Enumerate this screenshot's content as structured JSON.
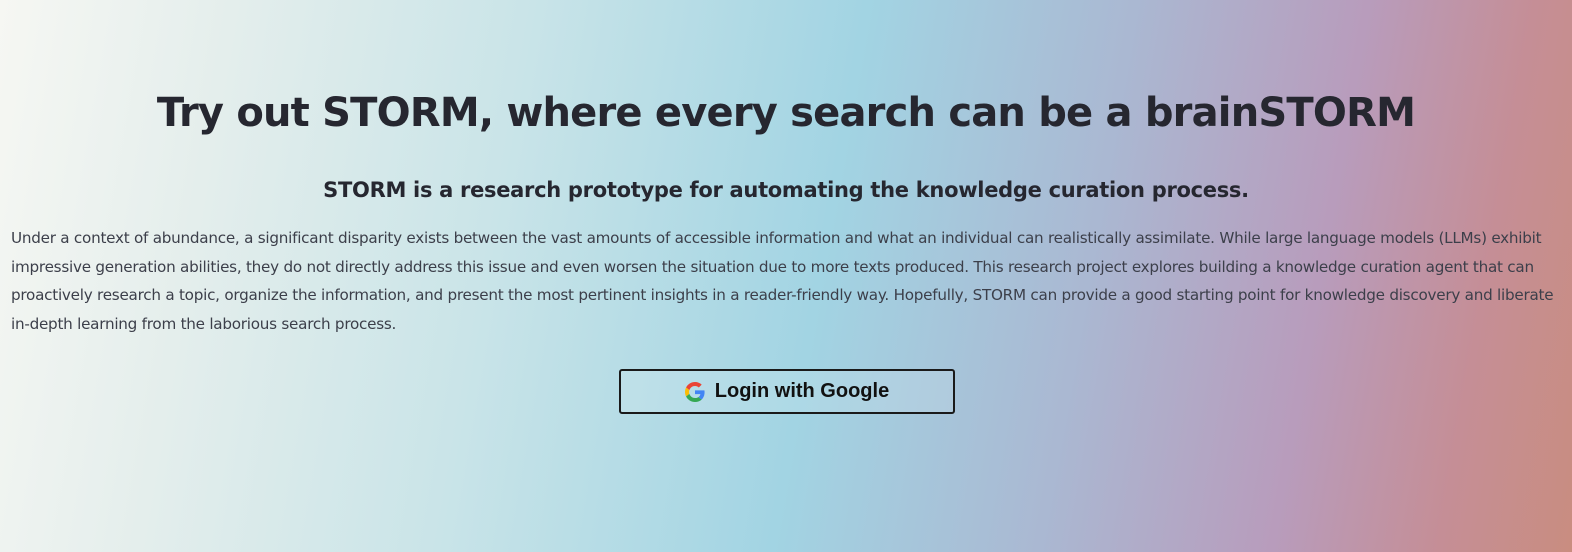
{
  "hero": {
    "title": "Try out STORM, where every search can be a brainSTORM",
    "subtitle": "STORM is a research prototype for automating the knowledge curation process.",
    "description": "Under a context of abundance, a significant disparity exists between the vast amounts of accessible information and what an individual can realistically assimilate. While large language models (LLMs) exhibit impressive generation abilities, they do not directly address this issue and even worsen the situation due to more texts produced. This research project explores building a knowledge curation agent that can proactively research a topic, organize the information, and present the most pertinent insights in a reader-friendly way. Hopefully, STORM can provide a good starting point for knowledge discovery and liberate in-depth learning from the laborious search process."
  },
  "login": {
    "label": "Login with Google",
    "icon": "google-g-icon"
  },
  "colors": {
    "text": "#262730",
    "button_border": "#1a1a1a",
    "google_blue": "#4285F4",
    "google_red": "#EA4335",
    "google_yellow": "#FBBC05",
    "google_green": "#34A853"
  }
}
